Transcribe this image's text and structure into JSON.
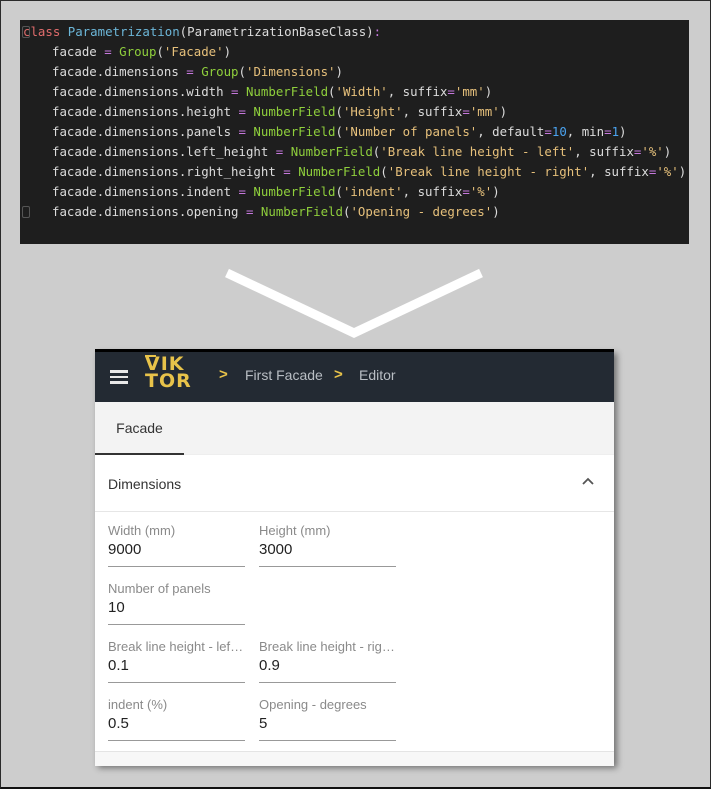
{
  "code": {
    "lines": [
      {
        "parts": [
          {
            "t": "class ",
            "c": "kw"
          },
          {
            "t": "Parametrization",
            "c": "cls"
          },
          {
            "t": "(ParametrizationBaseClass)",
            "c": ""
          },
          {
            "t": ":",
            "c": "op"
          }
        ],
        "indent": false
      },
      {
        "parts": [
          {
            "t": "facade ",
            "c": ""
          },
          {
            "t": "=",
            "c": "op"
          },
          {
            "t": " Group",
            "c": "fn"
          },
          {
            "t": "(",
            "c": ""
          },
          {
            "t": "'Facade'",
            "c": "str"
          },
          {
            "t": ")",
            "c": ""
          }
        ],
        "indent": true
      },
      {
        "parts": [
          {
            "t": "facade.dimensions ",
            "c": ""
          },
          {
            "t": "=",
            "c": "op"
          },
          {
            "t": " Group",
            "c": "fn"
          },
          {
            "t": "(",
            "c": ""
          },
          {
            "t": "'Dimensions'",
            "c": "str"
          },
          {
            "t": ")",
            "c": ""
          }
        ],
        "indent": true
      },
      {
        "parts": [
          {
            "t": "facade.dimensions.width ",
            "c": ""
          },
          {
            "t": "=",
            "c": "op"
          },
          {
            "t": " NumberField",
            "c": "fn"
          },
          {
            "t": "(",
            "c": ""
          },
          {
            "t": "'Width'",
            "c": "str"
          },
          {
            "t": ", suffix",
            "c": ""
          },
          {
            "t": "=",
            "c": "op"
          },
          {
            "t": "'mm'",
            "c": "str"
          },
          {
            "t": ")",
            "c": ""
          }
        ],
        "indent": true
      },
      {
        "parts": [
          {
            "t": "facade.dimensions.height ",
            "c": ""
          },
          {
            "t": "=",
            "c": "op"
          },
          {
            "t": " NumberField",
            "c": "fn"
          },
          {
            "t": "(",
            "c": ""
          },
          {
            "t": "'Height'",
            "c": "str"
          },
          {
            "t": ", suffix",
            "c": ""
          },
          {
            "t": "=",
            "c": "op"
          },
          {
            "t": "'mm'",
            "c": "str"
          },
          {
            "t": ")",
            "c": ""
          }
        ],
        "indent": true
      },
      {
        "parts": [
          {
            "t": "facade.dimensions.panels ",
            "c": ""
          },
          {
            "t": "=",
            "c": "op"
          },
          {
            "t": " NumberField",
            "c": "fn"
          },
          {
            "t": "(",
            "c": ""
          },
          {
            "t": "'Number of panels'",
            "c": "str"
          },
          {
            "t": ", default",
            "c": ""
          },
          {
            "t": "=",
            "c": "op"
          },
          {
            "t": "10",
            "c": "num"
          },
          {
            "t": ", min",
            "c": ""
          },
          {
            "t": "=",
            "c": "op"
          },
          {
            "t": "1",
            "c": "num"
          },
          {
            "t": ")",
            "c": ""
          }
        ],
        "indent": true
      },
      {
        "parts": [
          {
            "t": "facade.dimensions.left_height ",
            "c": ""
          },
          {
            "t": "=",
            "c": "op"
          },
          {
            "t": " NumberField",
            "c": "fn"
          },
          {
            "t": "(",
            "c": ""
          },
          {
            "t": "'Break line height - left'",
            "c": "str"
          },
          {
            "t": ", suffix",
            "c": ""
          },
          {
            "t": "=",
            "c": "op"
          },
          {
            "t": "'%'",
            "c": "str"
          },
          {
            "t": ")",
            "c": ""
          }
        ],
        "indent": true
      },
      {
        "parts": [
          {
            "t": "facade.dimensions.right_height ",
            "c": ""
          },
          {
            "t": "=",
            "c": "op"
          },
          {
            "t": " NumberField",
            "c": "fn"
          },
          {
            "t": "(",
            "c": ""
          },
          {
            "t": "'Break line height - right'",
            "c": "str"
          },
          {
            "t": ", suffix",
            "c": ""
          },
          {
            "t": "=",
            "c": "op"
          },
          {
            "t": "'%'",
            "c": "str"
          },
          {
            "t": ")",
            "c": ""
          }
        ],
        "indent": true
      },
      {
        "parts": [
          {
            "t": "facade.dimensions.indent ",
            "c": ""
          },
          {
            "t": "=",
            "c": "op"
          },
          {
            "t": " NumberField",
            "c": "fn"
          },
          {
            "t": "(",
            "c": ""
          },
          {
            "t": "'indent'",
            "c": "str"
          },
          {
            "t": ", suffix",
            "c": ""
          },
          {
            "t": "=",
            "c": "op"
          },
          {
            "t": "'%'",
            "c": "str"
          },
          {
            "t": ")",
            "c": ""
          }
        ],
        "indent": true
      },
      {
        "parts": [
          {
            "t": "facade.dimensions.opening ",
            "c": ""
          },
          {
            "t": "=",
            "c": "op"
          },
          {
            "t": " NumberField",
            "c": "fn"
          },
          {
            "t": "(",
            "c": ""
          },
          {
            "t": "'Opening - degrees'",
            "c": "str"
          },
          {
            "t": ")",
            "c": ""
          }
        ],
        "indent": true
      }
    ]
  },
  "app": {
    "logo_top": "VIK",
    "logo_bottom": "TOR",
    "breadcrumb": [
      "First Facade",
      "Editor"
    ],
    "breadcrumb_sep": ">",
    "tabs": [
      {
        "label": "Facade",
        "active": true
      }
    ],
    "section": {
      "title": "Dimensions",
      "expanded": true
    },
    "fields": [
      {
        "label": "Width (mm)",
        "value": "9000"
      },
      {
        "label": "Height (mm)",
        "value": "3000"
      },
      {
        "label": "Number of panels",
        "value": "10"
      },
      {
        "label": "Break line height - left ...",
        "value": "0.1"
      },
      {
        "label": "Break line height - righ...",
        "value": "0.9"
      },
      {
        "label": "indent (%)",
        "value": "0.5"
      },
      {
        "label": "Opening - degrees",
        "value": "5"
      }
    ]
  },
  "colors": {
    "accent": "#e8c34a",
    "topbar": "#232a33",
    "code_bg": "#1e1e1e"
  }
}
